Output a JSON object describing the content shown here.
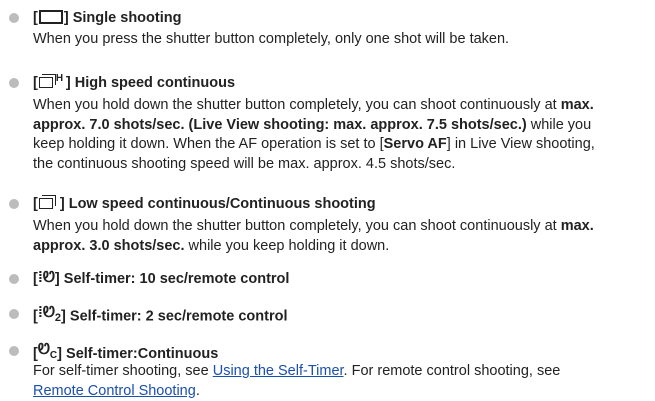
{
  "items": [
    {
      "icon": "single-shooting-icon",
      "title": "Single shooting",
      "lines": [
        "When you press the shutter button completely, only one shot will be taken."
      ]
    },
    {
      "icon": "high-speed-continuous-icon",
      "title": "High speed continuous",
      "lines": [
        "When you hold down the shutter button completely, you can shoot continuously at",
        "max.",
        "approx. 7.0 shots/sec. (Live View shooting: max. approx. 7.5 shots/sec.)",
        " while you",
        "keep holding it down. When the AF operation is set to [",
        "Servo AF",
        "] in Live View shooting,",
        "the continuous shooting speed will be max. approx. 4.5 shots/sec."
      ]
    },
    {
      "icon": "low-speed-continuous-icon",
      "title": "Low speed continuous/Continuous shooting",
      "lines": [
        "When you hold down the shutter button completely, you can shoot continuously at",
        "max.",
        "approx. 3.0 shots/sec.",
        " while you keep holding it down."
      ]
    },
    {
      "icon": "self-timer-10-icon",
      "title": "Self-timer: 10 sec/remote control"
    },
    {
      "icon": "self-timer-2-icon",
      "title": "Self-timer: 2 sec/remote control"
    },
    {
      "icon": "self-timer-continuous-icon",
      "title": "Self-timer:Continuous",
      "lines": [
        "For self-timer shooting, see ",
        "Using the Self-Timer",
        ". For remote control shooting, see",
        "Remote Control Shooting",
        "."
      ]
    }
  ],
  "glyphs": {
    "open": "[",
    "close": "]",
    "h": "H",
    "timer10": "ⁱ̈Ꮼ",
    "timer": "Ꮼ",
    "sub2": "2",
    "subC": "C"
  }
}
